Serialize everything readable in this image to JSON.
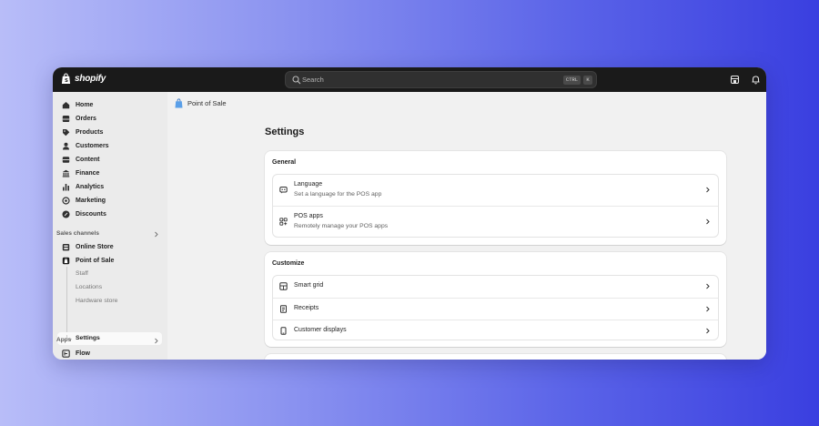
{
  "topbar": {
    "brand": "shopify",
    "search_placeholder": "Search",
    "kbd_ctrl": "CTRL",
    "kbd_k": "K"
  },
  "sidebar": {
    "items": [
      {
        "label": "Home",
        "icon": "home-icon"
      },
      {
        "label": "Orders",
        "icon": "orders-icon"
      },
      {
        "label": "Products",
        "icon": "tag-icon"
      },
      {
        "label": "Customers",
        "icon": "person-icon"
      },
      {
        "label": "Content",
        "icon": "content-icon"
      },
      {
        "label": "Finance",
        "icon": "bank-icon"
      },
      {
        "label": "Analytics",
        "icon": "bar-chart-icon"
      },
      {
        "label": "Marketing",
        "icon": "target-icon"
      },
      {
        "label": "Discounts",
        "icon": "discount-icon"
      }
    ],
    "sales_channels_label": "Sales channels",
    "channels": [
      {
        "label": "Online Store",
        "icon": "online-store-icon"
      },
      {
        "label": "Point of Sale",
        "icon": "pos-icon"
      }
    ],
    "pos_sub": [
      "Staff",
      "Locations",
      "Hardware store"
    ],
    "active_sub": "Settings",
    "apps_label": "Apps",
    "apps": [
      {
        "label": "Flow",
        "icon": "flow-icon"
      }
    ]
  },
  "main": {
    "breadcrumb": "Point of Sale",
    "title": "Settings",
    "general": {
      "title": "General",
      "rows": [
        {
          "title": "Language",
          "subtitle": "Set a language for the POS app",
          "icon": "language-icon"
        },
        {
          "title": "POS apps",
          "subtitle": "Remotely manage your POS apps",
          "icon": "apps-icon"
        }
      ]
    },
    "customize": {
      "title": "Customize",
      "rows": [
        {
          "title": "Smart grid",
          "icon": "smart-grid-icon"
        },
        {
          "title": "Receipts",
          "icon": "receipt-icon"
        },
        {
          "title": "Customer displays",
          "icon": "display-icon"
        }
      ]
    }
  }
}
